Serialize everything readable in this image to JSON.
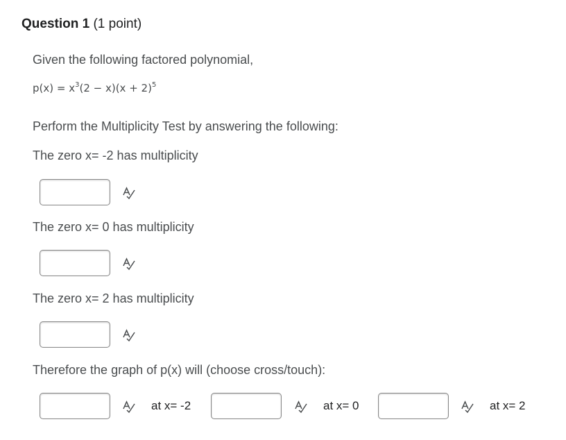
{
  "question": {
    "title": "Question 1",
    "points": "(1 point)"
  },
  "prompt": {
    "intro": "Given the following factored polynomial,",
    "poly": {
      "lhs": "p(x) = x",
      "exp1": "3",
      "mid": "(2 − x)(x + 2)",
      "exp2": "5"
    },
    "instruction": "Perform the Multiplicity Test by answering the following:"
  },
  "parts": [
    {
      "label": "The zero x= -2 has multiplicity",
      "value": ""
    },
    {
      "label": "The zero x= 0 has multiplicity",
      "value": ""
    },
    {
      "label": "The zero x= 2 has multiplicity",
      "value": ""
    }
  ],
  "behavior": {
    "label": "Therefore the graph of p(x) will (choose cross/touch):",
    "fields": [
      {
        "suffix": "at x= -2",
        "value": ""
      },
      {
        "suffix": "at x= 0",
        "value": ""
      },
      {
        "suffix": "at x= 2",
        "value": ""
      }
    ]
  },
  "icons": {
    "spell_check": "spell-check-icon"
  },
  "colors": {
    "text": "#494c4e",
    "heading": "#202122",
    "border": "#868686"
  }
}
